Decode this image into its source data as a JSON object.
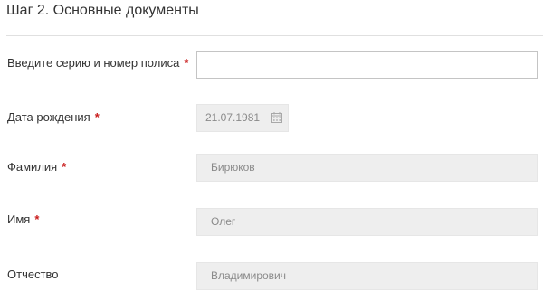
{
  "step": {
    "title": "Шаг 2. Основные документы"
  },
  "fields": {
    "policy": {
      "label": "Введите серию и номер полиса",
      "required_mark": "*",
      "value": "",
      "placeholder": ""
    },
    "birth_date": {
      "label": "Дата рождения",
      "required_mark": "*",
      "value": "21.07.1981",
      "icon": "calendar-icon"
    },
    "last_name": {
      "label": "Фамилия",
      "required_mark": "*",
      "value": "Бирюков"
    },
    "first_name": {
      "label": "Имя",
      "required_mark": "*",
      "value": "Олег"
    },
    "patronymic": {
      "label": "Отчество",
      "value": "Владимирович"
    }
  },
  "colors": {
    "required": "#c91c1c",
    "disabled_bg": "#eeeeee",
    "input_border": "#c4c4c4"
  }
}
